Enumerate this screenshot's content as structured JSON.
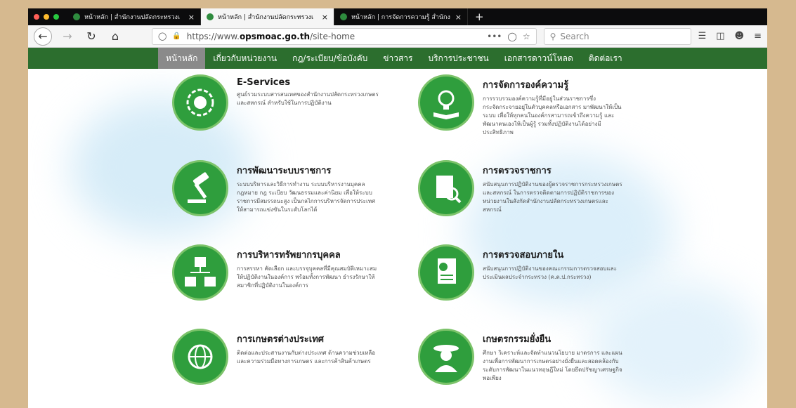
{
  "browser": {
    "tabs": [
      {
        "label": "หน้าหลัก | สำนักงานปลัดกระทรวงเ",
        "active": false
      },
      {
        "label": "หน้าหลัก | สำนักงานปลัดกระทรวงเ",
        "active": true
      },
      {
        "label": "หน้าหลัก | การจัดการความรู้ สำนักง",
        "active": false
      }
    ],
    "tab_close": "×",
    "new_tab": "+",
    "url_prefix": "https://www.",
    "url_domain": "opsmoac.go.th",
    "url_path": "/site-home",
    "url_menu": "•••",
    "search_placeholder": "Search"
  },
  "sitenav": {
    "items": [
      {
        "label": "หน้าหลัก",
        "active": true
      },
      {
        "label": "เกี่ยวกับหน่วยงาน"
      },
      {
        "label": "กฎ/ระเบียบ/ข้อบังคับ"
      },
      {
        "label": "ข่าวสาร"
      },
      {
        "label": "บริการประชาชน"
      },
      {
        "label": "เอกสารดาวน์โหลด"
      },
      {
        "label": "ติดต่อเรา"
      }
    ]
  },
  "services": [
    {
      "title": "E-Services",
      "desc": "ศูนย์รวมระบบสารสนเทศของสำนักงานปลัดกระทรวงเกษตรและสหกรณ์ สำหรับใช้ในการปฏิบัติงาน",
      "icon": "e-services-icon"
    },
    {
      "title": "การจัดการองค์ความรู้",
      "desc": "การรวบรวมองค์ความรู้ที่มีอยู่ในส่วนราชการซึ่งกระจัดกระจายอยู่ในตัวบุคคลหรือเอกสาร มาพัฒนาให้เป็นระบบ เพื่อให้ทุกคนในองค์กรสามารถเข้าถึงความรู้ และพัฒนาตนเองให้เป็นผู้รู้ รวมทั้งปฏิบัติงานได้อย่างมีประสิทธิภาพ",
      "icon": "lightbulb-book-icon"
    },
    {
      "title": "การพัฒนาระบบราชการ",
      "desc": "ระบบบริหารและวิธีการทำงาน ระบบบริหารงานบุคคล กฎหมาย กฎ ระเบียบ วัฒนธรรมและค่านิยม เพื่อให้ระบบราชการมีสมรรถนะสูง เป็นกลไกการบริหารจัดการประเทศให้สามารถแข่งขันในระดับโลกได้",
      "icon": "gavel-icon"
    },
    {
      "title": "การตรวจราชการ",
      "desc": "สนับสนุนการปฏิบัติงานของผู้ตรวจราชการกระทรวงเกษตรและสหกรณ์ ในการตรวจติดตามการปฏิบัติราชการของหน่วยงานในสังกัดสำนักงานปลัดกระทรวงเกษตรและสหกรณ์",
      "icon": "document-search-icon"
    },
    {
      "title": "การบริหารทรัพยากรบุคคล",
      "desc": "การสรรหา คัดเลือก และบรรจุบุคคลที่มีคุณสมบัติเหมาะสมให้ปฏิบัติงานในองค์การ พร้อมทั้งการพัฒนา ธำรงรักษาให้สมาชิกที่ปฏิบัติงานในองค์การ",
      "icon": "people-network-icon"
    },
    {
      "title": "การตรวจสอบภายใน",
      "desc": "สนับสนุนการปฏิบัติงานของคณะกรรมการตรวจสอบและประเมินผลประจำกระทรวง (ค.ต.ป.กระทรวง)",
      "icon": "audit-report-icon"
    },
    {
      "title": "การเกษตรต่างประเทศ",
      "desc": "ติดต่อและประสานงานกับต่างประเทศ ด้านความช่วยเหลือและความร่วมมือทางการเกษตร และการค้าสินค้าเกษตร",
      "icon": "globe-plane-icon"
    },
    {
      "title": "เกษตรกรรมยั่งยืน",
      "desc": "ศึกษา วิเคราะห์และจัดทำแนวนโยบาย มาตรการ และแผนงานเพื่อการพัฒนาการเกษตรอย่างยั่งยืนและสอดคล้องกับระดับการพัฒนาในแนวทฤษฎีใหม่ โดยยึดปรัชญาเศรษฐกิจพอเพียง",
      "icon": "farmer-icon"
    }
  ],
  "colors": {
    "nav_green": "#2c6e2e",
    "icon_green": "#2f9e3d",
    "nav_active": "#8a8a8a",
    "page_bg_border": "#d6b98f"
  }
}
